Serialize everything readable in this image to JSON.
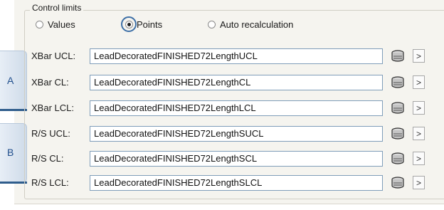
{
  "group_title": "Control limits",
  "radios": [
    {
      "label": "Values",
      "selected": false
    },
    {
      "label": "Points",
      "selected": true
    },
    {
      "label": "Auto recalculation",
      "selected": false
    }
  ],
  "sections": [
    {
      "letter": "A"
    },
    {
      "letter": "B"
    }
  ],
  "rows": [
    {
      "label": "XBar UCL:",
      "value": "LeadDecoratedFINISHED72LengthUCL"
    },
    {
      "label": "XBar CL:",
      "value": "LeadDecoratedFINISHED72LengthCL"
    },
    {
      "label": "XBar LCL:",
      "value": "LeadDecoratedFINISHED72LengthLCL"
    },
    {
      "label": "R/S UCL:",
      "value": "LeadDecoratedFINISHED72LengthSUCL"
    },
    {
      "label": "R/S CL:",
      "value": "LeadDecoratedFINISHED72LengthSCL"
    },
    {
      "label": "R/S LCL:",
      "value": "LeadDecoratedFINISHED72LengthSLCL"
    }
  ],
  "row_buttons": {
    "browse_icon": "database-icon",
    "expand_label": ">"
  },
  "colors": {
    "highlight_ring": "#3d6fa6",
    "field_border": "#7f9db9",
    "panel_bg": "#f5f4ef"
  }
}
